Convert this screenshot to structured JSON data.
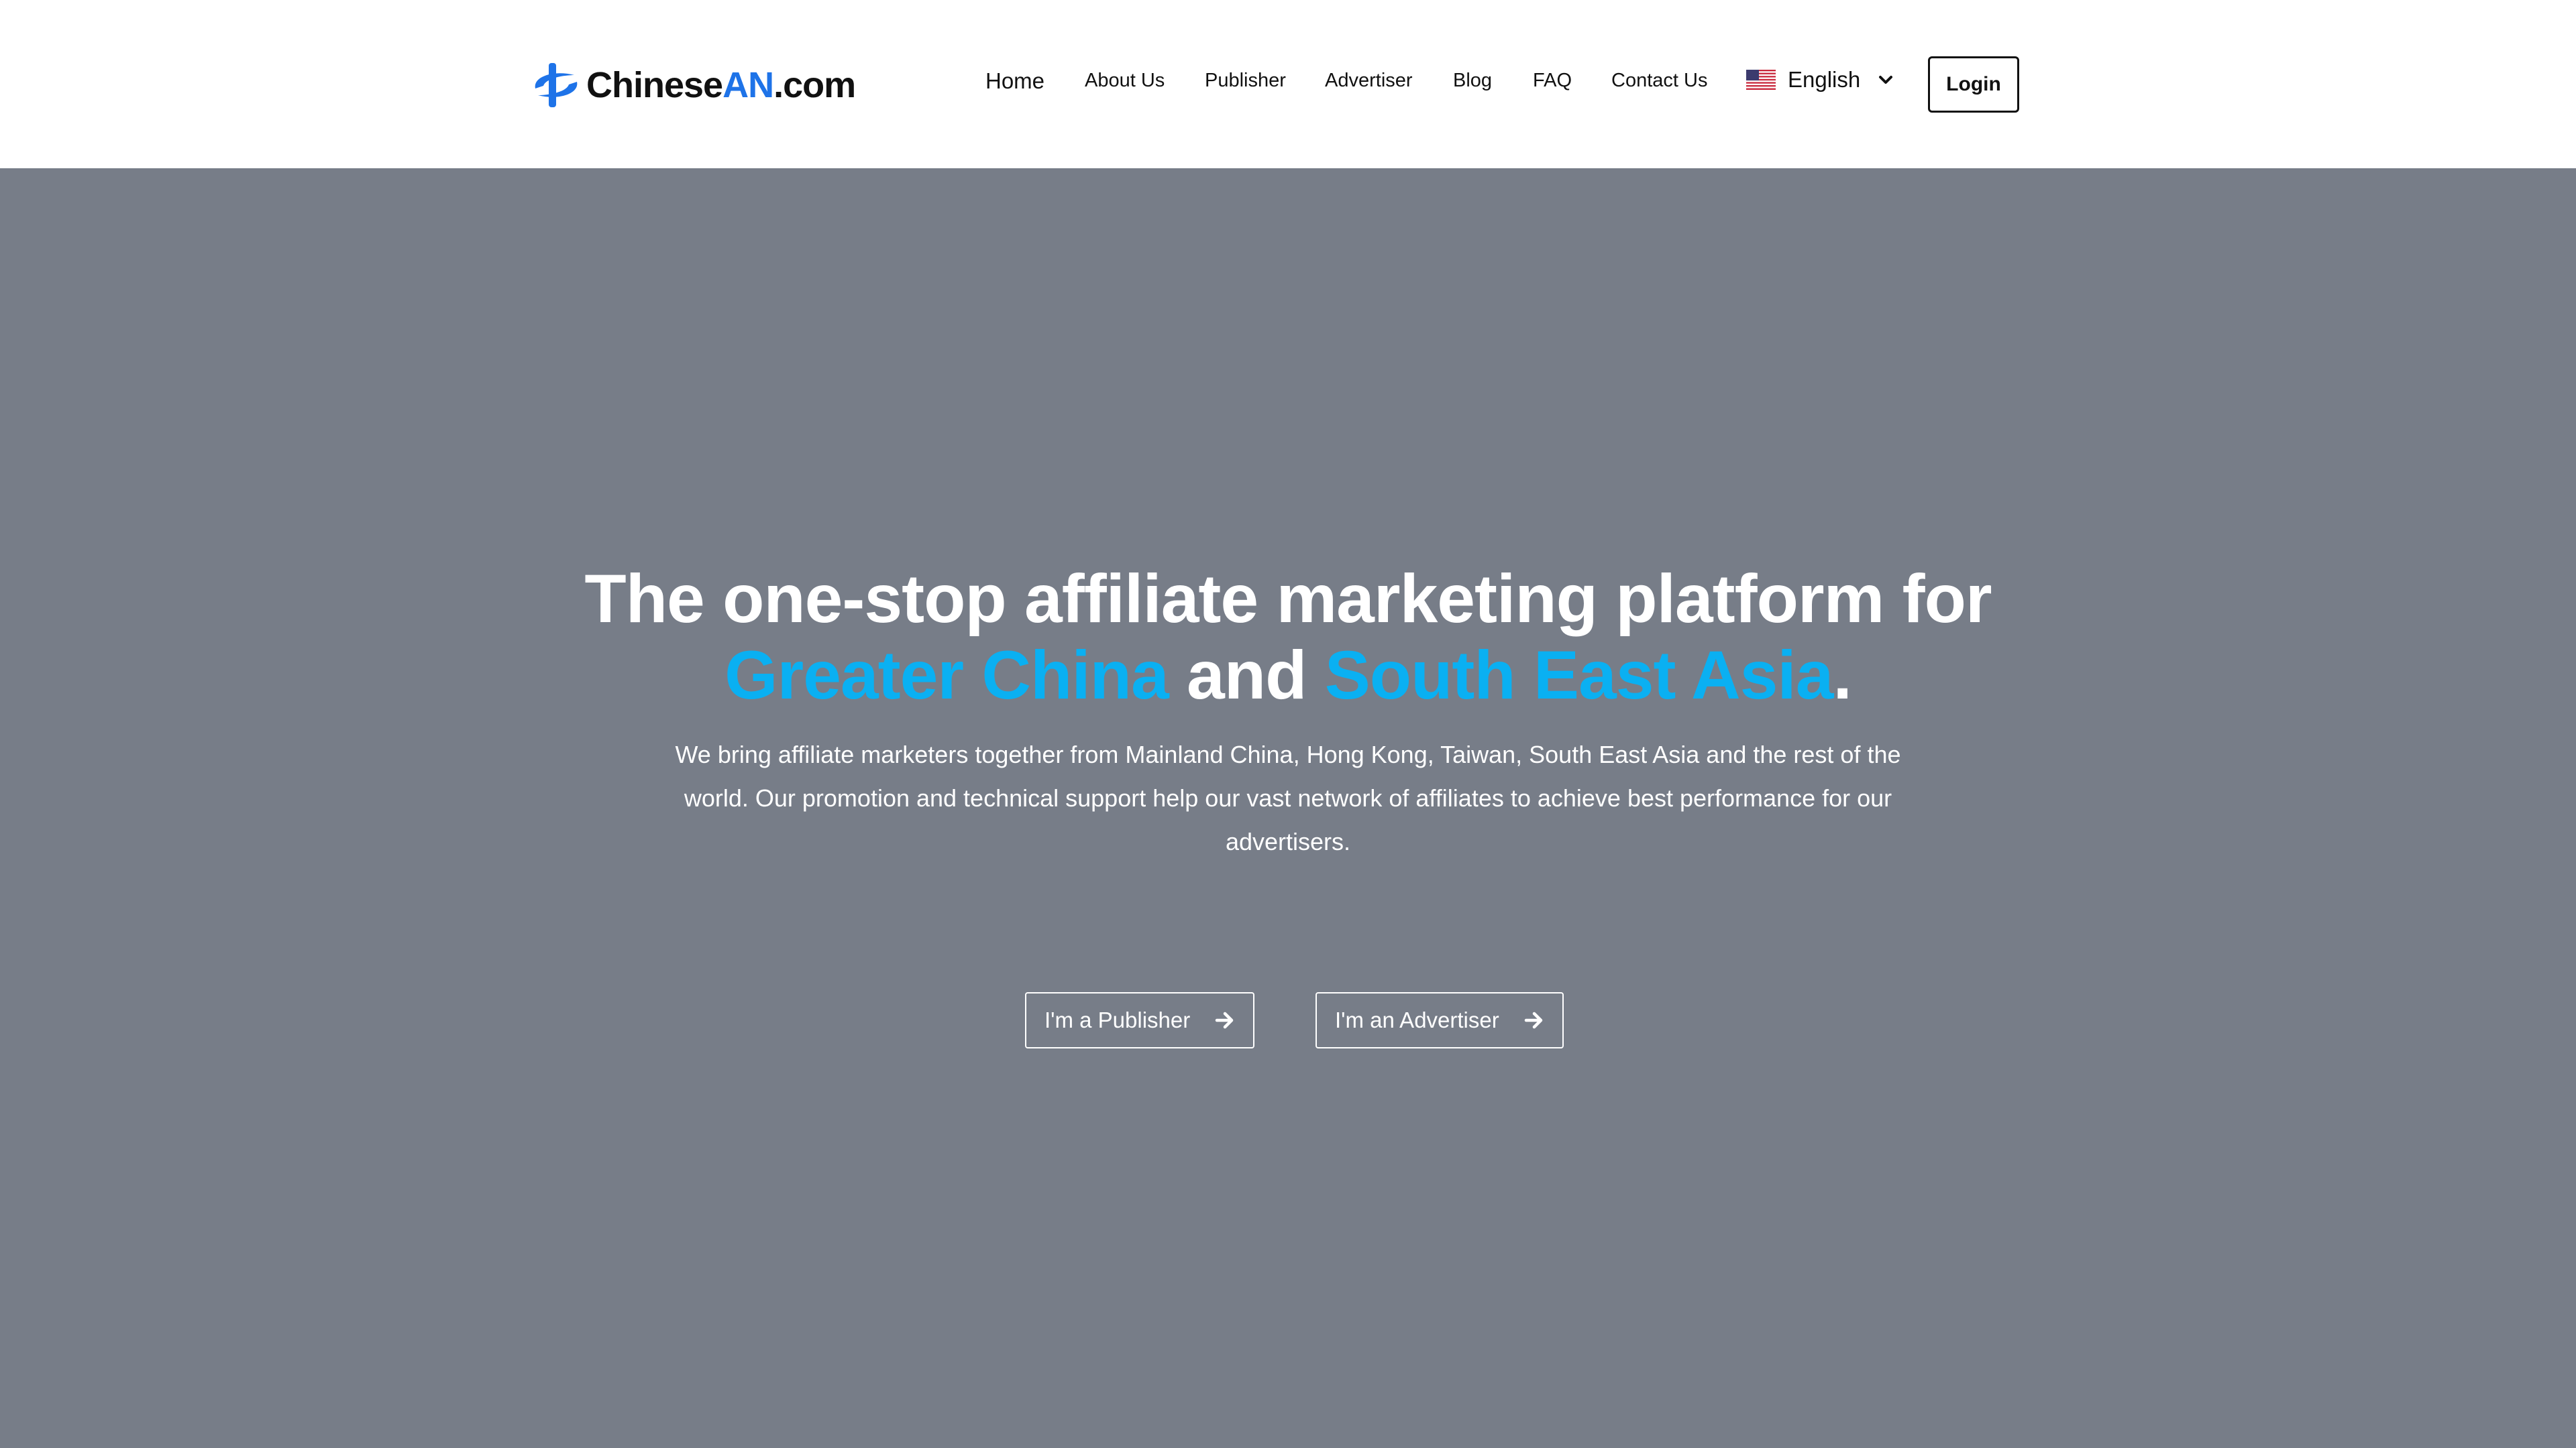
{
  "brand": {
    "name_main": "Chinese",
    "name_accent": "AN",
    "name_suffix": ".com",
    "accent_color": "#1e73e8",
    "logo_icon": "chinesean-logo-icon"
  },
  "nav": {
    "items": [
      {
        "label": "Home"
      },
      {
        "label": "About Us"
      },
      {
        "label": "Publisher"
      },
      {
        "label": "Advertiser"
      },
      {
        "label": "Blog"
      },
      {
        "label": "FAQ"
      },
      {
        "label": "Contact Us"
      }
    ],
    "language": {
      "label": "English",
      "flag_icon": "us-flag-icon",
      "dropdown_icon": "chevron-down-icon"
    },
    "login_label": "Login"
  },
  "hero": {
    "background_color": "#777d88",
    "highlight_color": "#0ab0f2",
    "headline_line1": "The one-stop affiliate marketing platform for",
    "headline_highlight1": "Greater China",
    "headline_and": " and ",
    "headline_highlight2": "South East Asia",
    "headline_period": ".",
    "description": "We bring affiliate marketers together from Mainland China, Hong Kong, Taiwan, South East Asia and the rest of the world. Our promotion and technical support help our vast network of affiliates to achieve best performance for our advertisers.",
    "buttons": [
      {
        "label": "I'm a Publisher",
        "icon": "arrow-right-icon"
      },
      {
        "label": "I'm an Advertiser",
        "icon": "arrow-right-icon"
      }
    ]
  }
}
